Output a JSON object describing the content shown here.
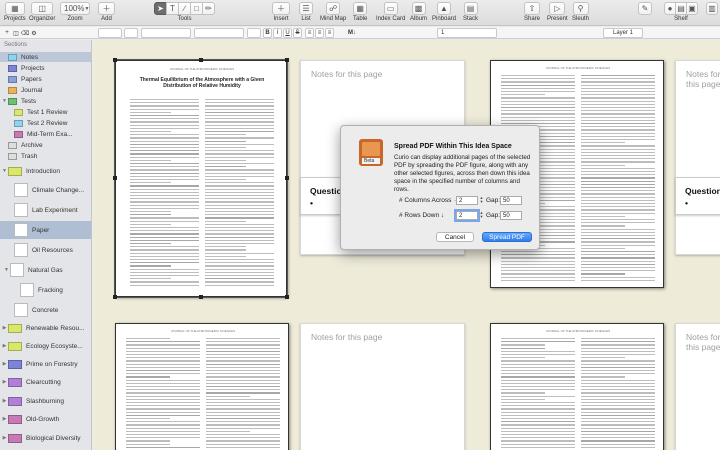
{
  "toolbar": {
    "projects": "Projects",
    "organizer": "Organizer",
    "zoom_value": "100%",
    "zoom_label": "Zoom",
    "add": "Add",
    "tools": "Tools",
    "insert": "Insert",
    "list": "List",
    "mind_map": "Mind Map",
    "table": "Table",
    "index_card": "Index Card",
    "album": "Album",
    "pinboard": "Pinboard",
    "stack": "Stack",
    "share": "Share",
    "present": "Present",
    "sleuth": "Sleuth",
    "shelf": "Shelf"
  },
  "formatbar": {
    "bold": "B",
    "italic": "I",
    "underline": "U",
    "strike": "S",
    "md": "M↓",
    "page_value": "1",
    "layer": "Layer 1"
  },
  "sidebar": {
    "header": "Sections",
    "items": [
      {
        "label": "Notes",
        "color": "#8fd3ee"
      },
      {
        "label": "Projects",
        "color": "#7d83d8"
      },
      {
        "label": "Papers",
        "color": "#8aa0d8"
      },
      {
        "label": "Journal",
        "color": "#e8b45a"
      },
      {
        "label": "Tests",
        "color": "#6fbf73"
      },
      {
        "label": "Test 1 Review",
        "color": "#d9e86a"
      },
      {
        "label": "Test 2 Review",
        "color": "#8fd3ee"
      },
      {
        "label": "Mid-Term Exa...",
        "color": "#c77ab5"
      },
      {
        "label": "Archive",
        "color": ""
      },
      {
        "label": "Trash",
        "color": ""
      },
      {
        "label": "Introduction",
        "color": "#d9e86a"
      },
      {
        "label": "Climate Change...",
        "color": ""
      },
      {
        "label": "Lab Experiment",
        "color": ""
      },
      {
        "label": "Paper",
        "color": ""
      },
      {
        "label": "Oil Resources",
        "color": ""
      },
      {
        "label": "Natural Gas",
        "color": ""
      },
      {
        "label": "Fracking",
        "color": ""
      },
      {
        "label": "Concrete",
        "color": ""
      },
      {
        "label": "Renewable Resou...",
        "color": "#d9e86a"
      },
      {
        "label": "Ecology Ecosyste...",
        "color": "#d9e86a"
      },
      {
        "label": "Prime on Forestry",
        "color": "#7d83d8"
      },
      {
        "label": "Clearcutting",
        "color": "#b07fd8"
      },
      {
        "label": "Slashburning",
        "color": "#b07fd8"
      },
      {
        "label": "Old-Growth",
        "color": "#c77ab5"
      },
      {
        "label": "Biological Diversity",
        "color": "#c77ab5"
      }
    ]
  },
  "canvas": {
    "note_title": "Notes for this page",
    "question_label": "Question",
    "bullet": "•",
    "paper_title": "Thermal Equilibrium of the Atmosphere with a Given Distribution of Relative Humidity",
    "journal_header": "JOURNAL OF THE ATMOSPHERIC SCIENCES"
  },
  "dialog": {
    "title": "Spread PDF Within This Idea Space",
    "body": "Curio can display additional pages of the selected PDF by spreading the PDF figure, along with any other selected figures, across then down this idea space in the specified number of columns and rows.",
    "columns_label": "# Columns Across →",
    "columns_value": "2",
    "rows_label": "# Rows Down ↓",
    "rows_value": "2",
    "gap_label": "Gap:",
    "gap_columns_value": "50",
    "gap_rows_value": "50",
    "cancel": "Cancel",
    "confirm": "Spread PDF",
    "icon_badge": "Beta"
  },
  "colors": {
    "canvas_bg": "#eeebd9",
    "primary_button": "#2f7ef0",
    "selection": "#b0bed3"
  }
}
